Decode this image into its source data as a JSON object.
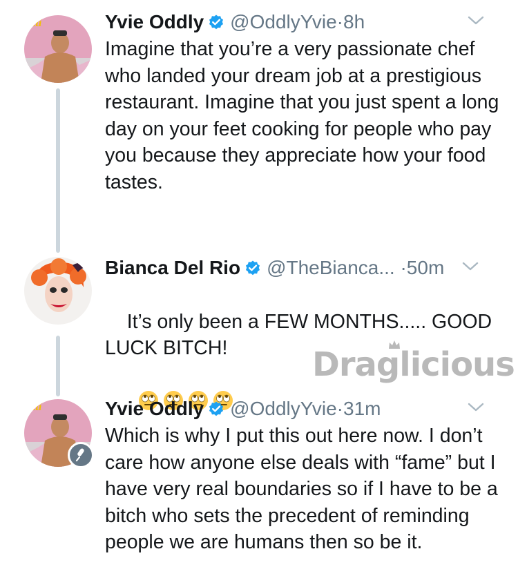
{
  "tweets": [
    {
      "name": "Yvie Oddly",
      "handle": "@OddlyYvie",
      "separator": "·",
      "time": "8h",
      "text": "Imagine that you’re a very passionate chef who landed your dream job at a prestigious restaurant. Imagine that you just spent a long day on your feet cooking for people who pay you because they appreciate how your food tastes.",
      "avatar_logo": "atti"
    },
    {
      "name": "Bianca Del Rio",
      "handle": "@TheBianca...",
      "separator": "·",
      "time": "50m",
      "text": "It’s only been a FEW MONTHS..... GOOD LUCK BITCH!",
      "emojis": [
        "eye-roll-emoji",
        "eye-roll-emoji",
        "eye-roll-emoji",
        "eye-roll-emoji"
      ]
    },
    {
      "name": "Yvie Oddly",
      "handle": "@OddlyYvie",
      "separator": "·",
      "time": "31m",
      "text": "Which is why I put this out here now. I don’t care how anyone else deals with “fame” but I have very real boundaries so if I have to be a bitch who sets the precedent of reminding people we are humans then so be it.",
      "avatar_logo": "atti"
    }
  ],
  "watermark": "Draglicious",
  "colors": {
    "verified": "#1da1f2",
    "secondary_text": "#657786",
    "thread_line": "#ccd6dd"
  },
  "icons": {
    "verified": "verified-badge-icon",
    "chevron": "chevron-down-icon",
    "mic": "microphone-icon"
  }
}
